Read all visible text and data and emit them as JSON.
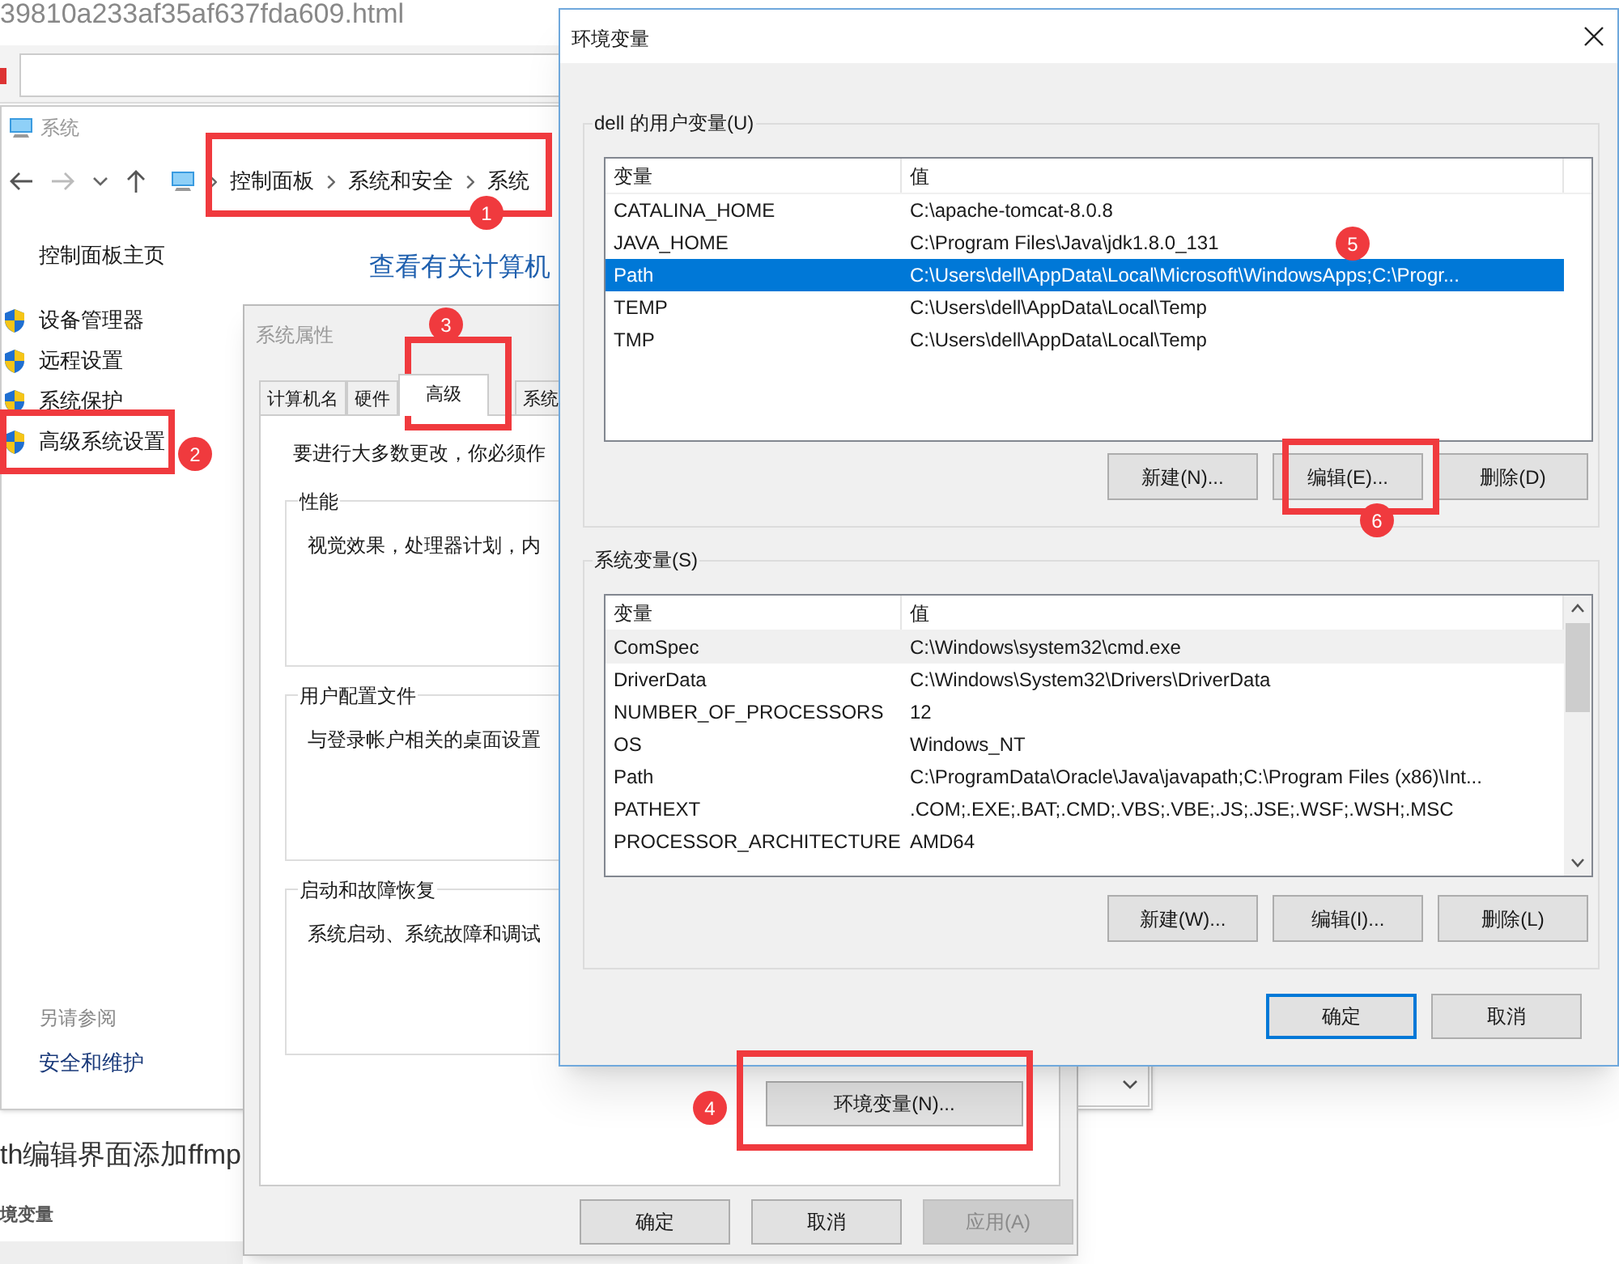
{
  "browser": {
    "url_text": "39810a233af35af637fda609.html"
  },
  "system_window": {
    "title": "系统",
    "breadcrumb": [
      "控制面板",
      "系统和安全",
      "系统"
    ],
    "home_link": "控制面板主页",
    "tasks": [
      "设备管理器",
      "远程设置",
      "系统保护",
      "高级系统设置"
    ],
    "see_also_title": "另请参阅",
    "see_also": [
      "安全和维护"
    ],
    "heading": "查看有关计算机"
  },
  "page_texts": [
    "th编辑界面添加ffmp",
    "境变量"
  ],
  "system_properties": {
    "title": "系统属性",
    "tabs": [
      {
        "label": "计算机名",
        "selected": false
      },
      {
        "label": "硬件",
        "selected": false
      },
      {
        "label": "高级",
        "selected": true
      },
      {
        "label": "系统",
        "selected": false
      }
    ],
    "intro": "要进行大多数更改，你必须作",
    "groups": [
      {
        "title": "性能",
        "text": "视觉效果，处理器计划，内"
      },
      {
        "title": "用户配置文件",
        "text": "与登录帐户相关的桌面设置"
      },
      {
        "title": "启动和故障恢复",
        "text": "系统启动、系统故障和调试"
      }
    ],
    "env_button": "环境变量(N)...",
    "buttons": [
      {
        "label": "确定",
        "disabled": false
      },
      {
        "label": "取消",
        "disabled": false
      },
      {
        "label": "应用(A)",
        "disabled": true
      }
    ]
  },
  "env_dialog": {
    "title": "环境变量",
    "user_vars": {
      "label": "dell 的用户变量(U)",
      "columns": [
        "变量",
        "值"
      ],
      "rows": [
        {
          "name": "CATALINA_HOME",
          "value": "C:\\apache-tomcat-8.0.8",
          "selected": false
        },
        {
          "name": "JAVA_HOME",
          "value": "C:\\Program Files\\Java\\jdk1.8.0_131",
          "selected": false
        },
        {
          "name": "Path",
          "value": "C:\\Users\\dell\\AppData\\Local\\Microsoft\\WindowsApps;C:\\Progr...",
          "selected": true
        },
        {
          "name": "TEMP",
          "value": "C:\\Users\\dell\\AppData\\Local\\Temp",
          "selected": false
        },
        {
          "name": "TMP",
          "value": "C:\\Users\\dell\\AppData\\Local\\Temp",
          "selected": false
        }
      ],
      "buttons": [
        "新建(N)...",
        "编辑(E)...",
        "删除(D)"
      ]
    },
    "system_vars": {
      "label": "系统变量(S)",
      "columns": [
        "变量",
        "值"
      ],
      "rows": [
        {
          "name": "ComSpec",
          "value": "C:\\Windows\\system32\\cmd.exe",
          "selected": false,
          "hovered": true
        },
        {
          "name": "DriverData",
          "value": "C:\\Windows\\System32\\Drivers\\DriverData",
          "selected": false,
          "hovered": false
        },
        {
          "name": "NUMBER_OF_PROCESSORS",
          "value": "12",
          "selected": false,
          "hovered": false
        },
        {
          "name": "OS",
          "value": "Windows_NT",
          "selected": false,
          "hovered": false
        },
        {
          "name": "Path",
          "value": "C:\\ProgramData\\Oracle\\Java\\javapath;C:\\Program Files (x86)\\Int...",
          "selected": false,
          "hovered": false
        },
        {
          "name": "PATHEXT",
          "value": ".COM;.EXE;.BAT;.CMD;.VBS;.VBE;.JS;.JSE;.WSF;.WSH;.MSC",
          "selected": false,
          "hovered": false
        },
        {
          "name": "PROCESSOR_ARCHITECTURE",
          "value": "AMD64",
          "selected": false,
          "hovered": false
        }
      ],
      "buttons": [
        "新建(W)...",
        "编辑(I)...",
        "删除(L)"
      ]
    },
    "buttons": [
      {
        "label": "确定",
        "default": true
      },
      {
        "label": "取消",
        "default": false
      }
    ]
  },
  "annotations": [
    {
      "number": "1"
    },
    {
      "number": "2"
    },
    {
      "number": "3"
    },
    {
      "number": "4"
    },
    {
      "number": "5"
    },
    {
      "number": "6"
    }
  ]
}
